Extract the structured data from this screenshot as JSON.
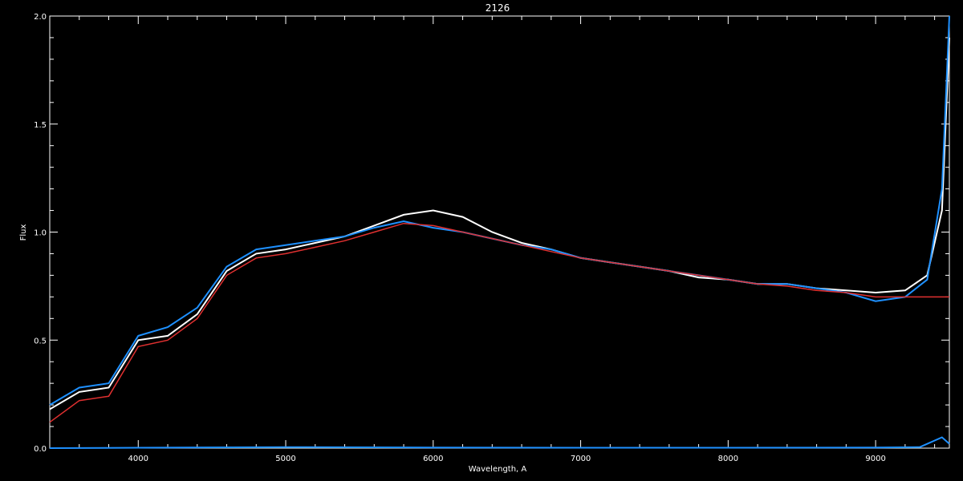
{
  "chart_data": {
    "type": "line",
    "title": "2126",
    "xlabel": "Wavelength, A",
    "ylabel": "Flux",
    "xlim": [
      3400,
      9500
    ],
    "ylim": [
      0,
      2.0
    ],
    "x_ticks": [
      4000,
      5000,
      6000,
      7000,
      8000,
      9000
    ],
    "x_tick_labels": [
      "4000",
      "5000",
      "6000",
      "7000",
      "8000",
      "9000"
    ],
    "y_ticks": [
      0.0,
      0.5,
      1.0,
      1.5,
      2.0
    ],
    "y_tick_labels": [
      "0.0",
      "0.5",
      "1.0",
      "1.5",
      "2.0"
    ],
    "grid": false,
    "background": "#000000",
    "axis_color": "#ffffff",
    "series": [
      {
        "color": "#ffffff",
        "x": [
          3400,
          3600,
          3800,
          4000,
          4200,
          4400,
          4600,
          4800,
          5000,
          5200,
          5400,
          5600,
          5800,
          6000,
          6200,
          6400,
          6600,
          6800,
          7000,
          7200,
          7400,
          7600,
          7800,
          8000,
          8200,
          8400,
          8600,
          8800,
          9000,
          9200,
          9350,
          9450,
          9500
        ],
        "y": [
          0.18,
          0.26,
          0.28,
          0.5,
          0.52,
          0.62,
          0.82,
          0.9,
          0.92,
          0.95,
          0.98,
          1.03,
          1.08,
          1.1,
          1.07,
          1.0,
          0.95,
          0.92,
          0.88,
          0.86,
          0.84,
          0.82,
          0.79,
          0.78,
          0.76,
          0.76,
          0.74,
          0.73,
          0.72,
          0.73,
          0.8,
          1.1,
          1.9
        ]
      },
      {
        "color": "#1e90ff",
        "x": [
          3400,
          3600,
          3800,
          4000,
          4200,
          4400,
          4600,
          4800,
          5000,
          5200,
          5400,
          5600,
          5800,
          6000,
          6200,
          6400,
          6600,
          6800,
          7000,
          7200,
          7400,
          7600,
          7800,
          8000,
          8200,
          8400,
          8600,
          8800,
          9000,
          9200,
          9350,
          9450,
          9500
        ],
        "y": [
          0.2,
          0.28,
          0.3,
          0.52,
          0.56,
          0.65,
          0.84,
          0.92,
          0.94,
          0.96,
          0.98,
          1.02,
          1.05,
          1.02,
          1.0,
          0.97,
          0.94,
          0.92,
          0.88,
          0.86,
          0.84,
          0.82,
          0.8,
          0.78,
          0.76,
          0.76,
          0.74,
          0.72,
          0.68,
          0.7,
          0.78,
          1.2,
          2.0
        ]
      },
      {
        "color": "#e03030",
        "x": [
          3400,
          3600,
          3800,
          4000,
          4200,
          4400,
          4600,
          4800,
          5000,
          5200,
          5400,
          5600,
          5800,
          6000,
          6200,
          6400,
          6600,
          6800,
          7000,
          7200,
          7400,
          7600,
          7800,
          8000,
          8200,
          8400,
          8600,
          8800,
          9000,
          9200,
          9350,
          9450,
          9500
        ],
        "y": [
          0.12,
          0.22,
          0.24,
          0.47,
          0.5,
          0.6,
          0.8,
          0.88,
          0.9,
          0.93,
          0.96,
          1.0,
          1.04,
          1.03,
          1.0,
          0.97,
          0.94,
          0.91,
          0.88,
          0.86,
          0.84,
          0.82,
          0.8,
          0.78,
          0.76,
          0.75,
          0.73,
          0.72,
          0.7,
          0.7,
          0.7,
          0.7,
          0.7
        ]
      },
      {
        "color": "#1e90ff",
        "x": [
          3400,
          4000,
          5000,
          6000,
          7000,
          8000,
          9000,
          9300,
          9450,
          9500
        ],
        "y": [
          0.0,
          0.002,
          0.005,
          0.003,
          0.002,
          0.002,
          0.003,
          0.005,
          0.05,
          0.02
        ]
      }
    ]
  }
}
